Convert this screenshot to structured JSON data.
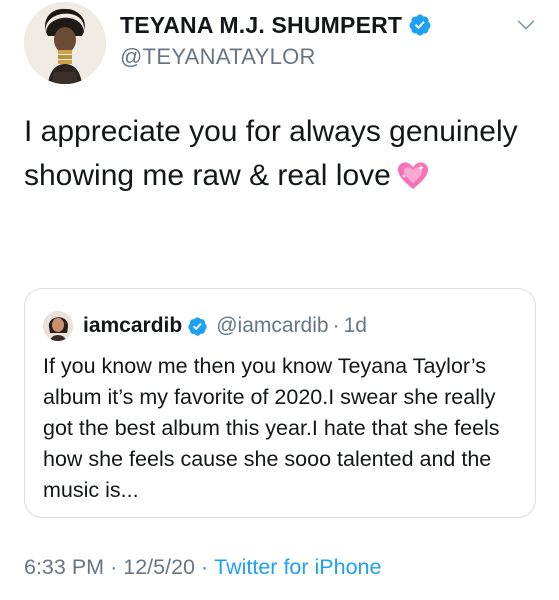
{
  "author": {
    "display_name": "TEYANA M.J. SHUMPERT",
    "handle": "@TEYANATAYLOR",
    "verified": true,
    "avatar_icon": "profile-photo"
  },
  "tweet": {
    "text": "I appreciate you for always genuinely showing me raw & real love",
    "emoji": "sparkling-heart-icon"
  },
  "quoted_tweet": {
    "display_name": "iamcardib",
    "handle": "@iamcardib",
    "separator": "·",
    "time": "1d",
    "verified": true,
    "text": "If you know me then you know Teyana Taylor’s album it’s my favorite of 2020.I swear she really got the best album this year.I hate that she feels how she feels cause she sooo talented and the music is..."
  },
  "meta": {
    "time": "6:33 PM",
    "separator": "·",
    "date": "12/5/20",
    "source": "Twitter for iPhone"
  },
  "colors": {
    "text": "#14171a",
    "secondary": "#657786",
    "link": "#1da1f2",
    "verified": "#1da1f2",
    "border": "#d8dee3",
    "heart": "#f472b6"
  }
}
